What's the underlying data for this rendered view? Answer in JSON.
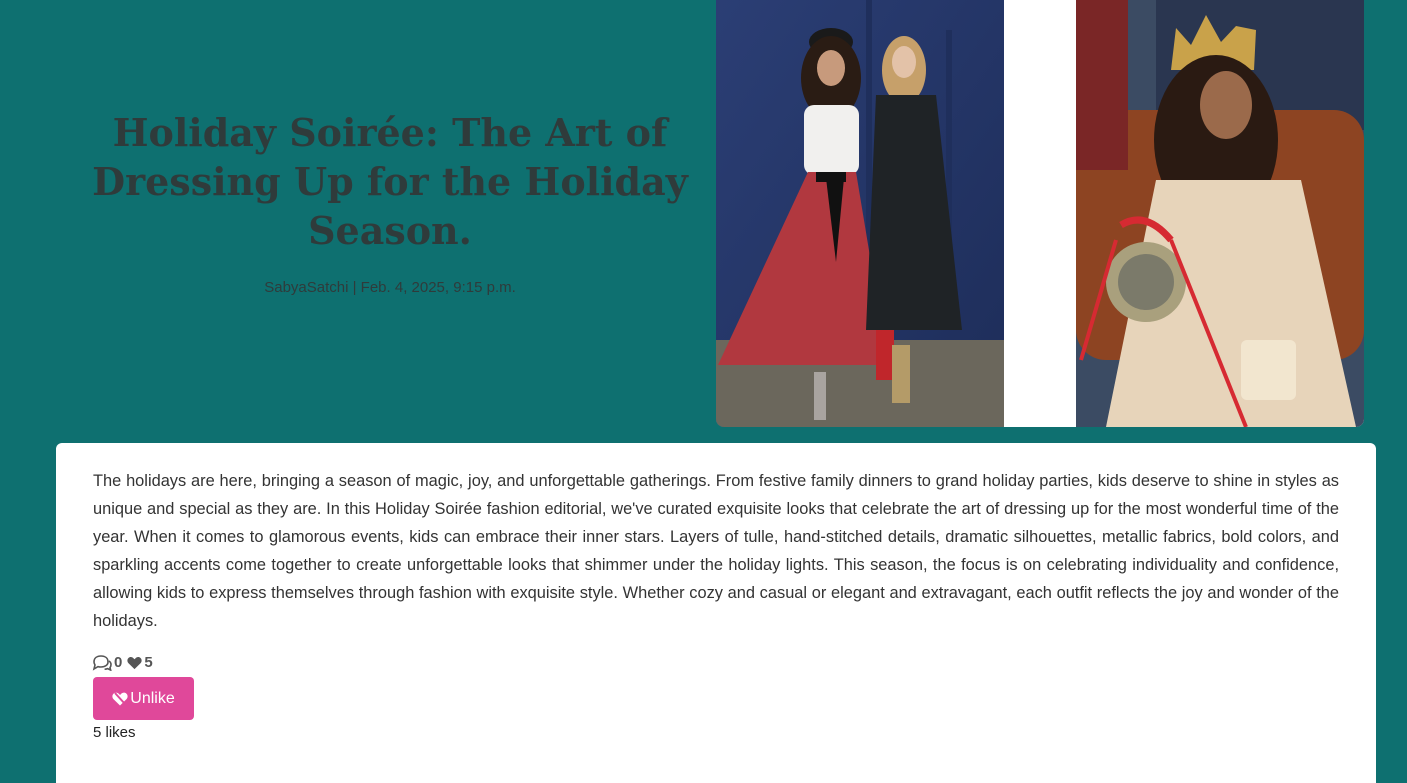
{
  "post": {
    "title": "Holiday Soirée: The Art of Dressing Up for the Holiday Season.",
    "author": "SabyaSatchi",
    "date": "Feb. 4, 2025, 9:15 p.m.",
    "byline": "SabyaSatchi | Feb. 4, 2025, 9:15 p.m.",
    "body": "The holidays are here, bringing a season of magic, joy, and unforgettable gatherings. From festive family dinners to grand holiday parties, kids deserve to shine in styles as unique and special as they are. In this Holiday Soirée fashion editorial, we've curated exquisite looks that celebrate the art of dressing up for the most wonderful time of the year. When it comes to glamorous events, kids can embrace their inner stars. Layers of tulle, hand-stitched details, dramatic silhouettes, metallic fabrics, bold colors, and sparkling accents come together to create unforgettable looks that shimmer under the holiday lights. This season, the focus is on celebrating individuality and confidence, allowing kids to express themselves through fashion with exquisite style. Whether cozy and casual or elegant and extravagant, each outfit reflects the joy and wonder of the holidays."
  },
  "stats": {
    "comments": "0",
    "likes": "5",
    "comment_icon": "comments-icon",
    "like_icon": "heart-icon"
  },
  "actions": {
    "unlike_label": "Unlike",
    "unlike_icon": "heart-crack-icon",
    "likes_text": "5 likes"
  },
  "colors": {
    "page_background": "#0e7070",
    "card_background": "#ffffff",
    "title_color": "#2f3b3b",
    "unlike_button": "#e0489a"
  }
}
